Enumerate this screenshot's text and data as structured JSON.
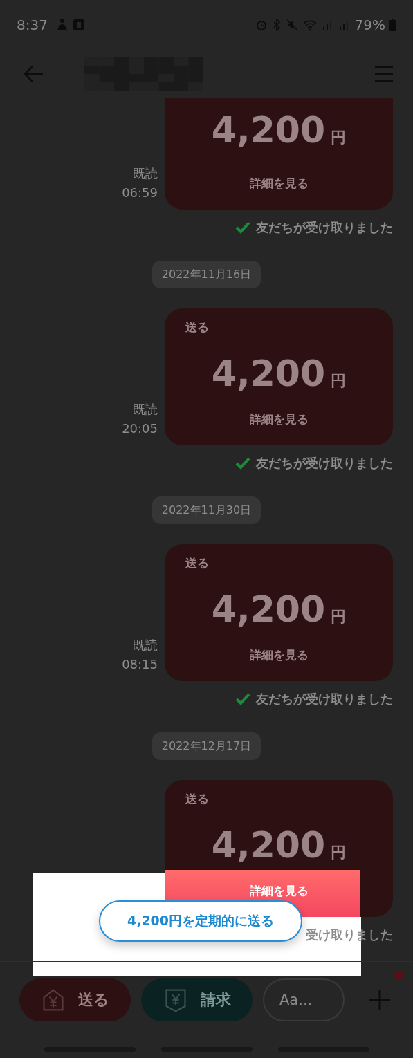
{
  "status_bar": {
    "time": "8:37",
    "battery": "79%"
  },
  "messages": [
    {
      "kind": "payment",
      "amount": "4,200",
      "currency": "円",
      "action": "詳細を見る",
      "read": "既読",
      "time": "06:59",
      "receipt": "友だちが受け取りました",
      "received": true,
      "highlighted": false
    },
    {
      "kind": "date",
      "text": "2022年11月16日"
    },
    {
      "kind": "payment",
      "label": "送る",
      "amount": "4,200",
      "currency": "円",
      "action": "詳細を見る",
      "read": "既読",
      "time": "20:05",
      "receipt": "友だちが受け取りました",
      "received": true,
      "highlighted": false
    },
    {
      "kind": "date",
      "text": "2022年11月30日"
    },
    {
      "kind": "payment",
      "label": "送る",
      "amount": "4,200",
      "currency": "円",
      "action": "詳細を見る",
      "read": "既読",
      "time": "08:15",
      "receipt": "友だちが受け取りました",
      "received": true,
      "highlighted": false
    },
    {
      "kind": "date",
      "text": "2022年12月17日"
    },
    {
      "kind": "payment",
      "label": "送る",
      "amount": "4,200",
      "currency": "円",
      "action": "詳細を見る",
      "receipt": "受け取りました",
      "highlighted": true
    }
  ],
  "tooltip_button": "4,200円を定期的に送る",
  "bottom_bar": {
    "send_button": "送る",
    "request_button": "請求",
    "input": {
      "placeholder": "Aa..."
    },
    "has_notification": true
  }
}
